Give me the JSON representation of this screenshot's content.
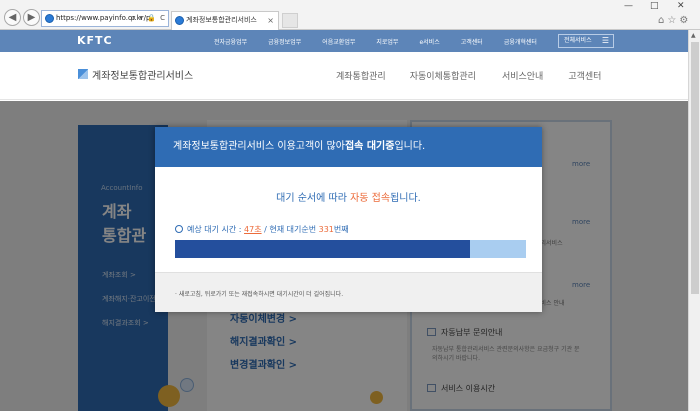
{
  "browser": {
    "address": "https://www.payinfo.or.kr/p",
    "address_icons": "ρ ▾ 🔒 C",
    "tab_title": "계좌정보통합관리서비스",
    "tab_close": "×",
    "back_icon": "arrow-left-icon",
    "forward_icon": "arrow-right-icon",
    "win_min": "—",
    "win_max": "□",
    "win_close": "✕",
    "tools": "⌂☆⚙"
  },
  "topbar": {
    "logo": "KFTC",
    "menu": [
      "전자금융업무",
      "금융정보업무",
      "어음교환업무",
      "지로업무",
      "e서비스",
      "고객센터",
      "금융개혁센터"
    ],
    "all_services": "전체서비스",
    "hamburger": "☰"
  },
  "sitenav": {
    "title": "계좌정보통합관리서비스",
    "menu": [
      "계좌통합관리",
      "자동이체통합관리",
      "서비스안내",
      "고객센터"
    ]
  },
  "page": {
    "left": {
      "en": "AccountInfo",
      "title_line1": "계좌",
      "title_line2": "통합관",
      "links": [
        "계좌조회 >",
        "계좌해지·잔고이전",
        "해지결과조회 >"
      ]
    },
    "mid_links": [
      "자동이체변경 >",
      "해지결과확인 >",
      "변경결과확인 >"
    ],
    "right": {
      "more": "more",
      "small_1": "관리서비스",
      "small_2": "서비스 안내",
      "head_1": "자동납부 문의안내",
      "desc": "자동납부 통합관리서비스 관련문의사항은 요금청구 기관 문의하시기 바랍니다.",
      "head_2": "서비스 이용시간"
    }
  },
  "modal": {
    "head_pre": "계좌정보통합관리서비스 이용고객이 많아 ",
    "head_bold": "접속 대기중",
    "head_post": "입니다.",
    "sub_pre": "대기 순서에 따라 ",
    "sub_accent": "자동 접속",
    "sub_post": "됩니다.",
    "wait_label": "예상 대기 시간 : ",
    "wait_time": "47초",
    "queue_label": " / 현재 대기순번 ",
    "queue_number": "331",
    "queue_suffix": "번째",
    "progress_ratio": 0.84,
    "footer": "· 새로고침, 뒤로가기 또는 재접속하시면 대기시간이 더 길어집니다."
  }
}
